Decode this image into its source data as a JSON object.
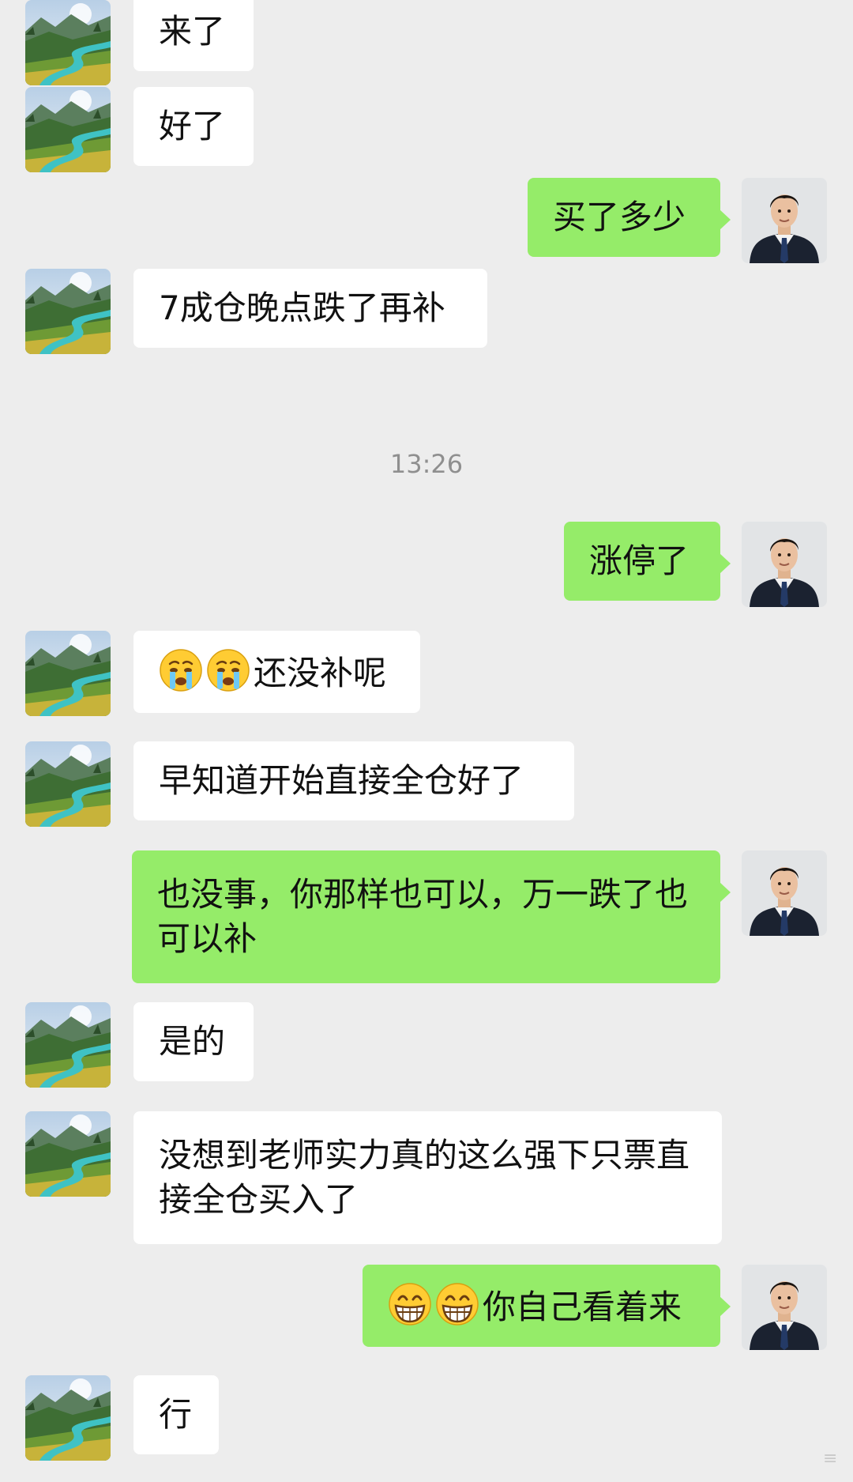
{
  "conversation": {
    "messages": [
      {
        "side": "left",
        "text": "来了"
      },
      {
        "side": "left",
        "text": "好了"
      },
      {
        "side": "right",
        "text": "买了多少"
      },
      {
        "side": "left",
        "text": "7成仓晚点跌了再补"
      },
      {
        "side": "time",
        "text": "13:26"
      },
      {
        "side": "right",
        "text": "涨停了"
      },
      {
        "side": "left",
        "text": "还没补呢",
        "emoji": "crying-face"
      },
      {
        "side": "left",
        "text": "早知道开始直接全仓好了"
      },
      {
        "side": "right",
        "text": "也没事，你那样也可以，万一跌了也可以补"
      },
      {
        "side": "left",
        "text": "是的"
      },
      {
        "side": "left",
        "text": "没想到老师实力真的这么强下只票直接全仓买入了"
      },
      {
        "side": "right",
        "text": "你自己看着来",
        "emoji": "grinning-face"
      },
      {
        "side": "left",
        "text": "行"
      }
    ]
  },
  "colors": {
    "background": "#ededed",
    "incoming_bubble": "#ffffff",
    "outgoing_bubble": "#95ec69",
    "timestamp_text": "#8f8f8f"
  },
  "icons": {
    "contact_avatar": "landscape-avatar-icon",
    "self_avatar": "businessman-avatar-icon"
  }
}
